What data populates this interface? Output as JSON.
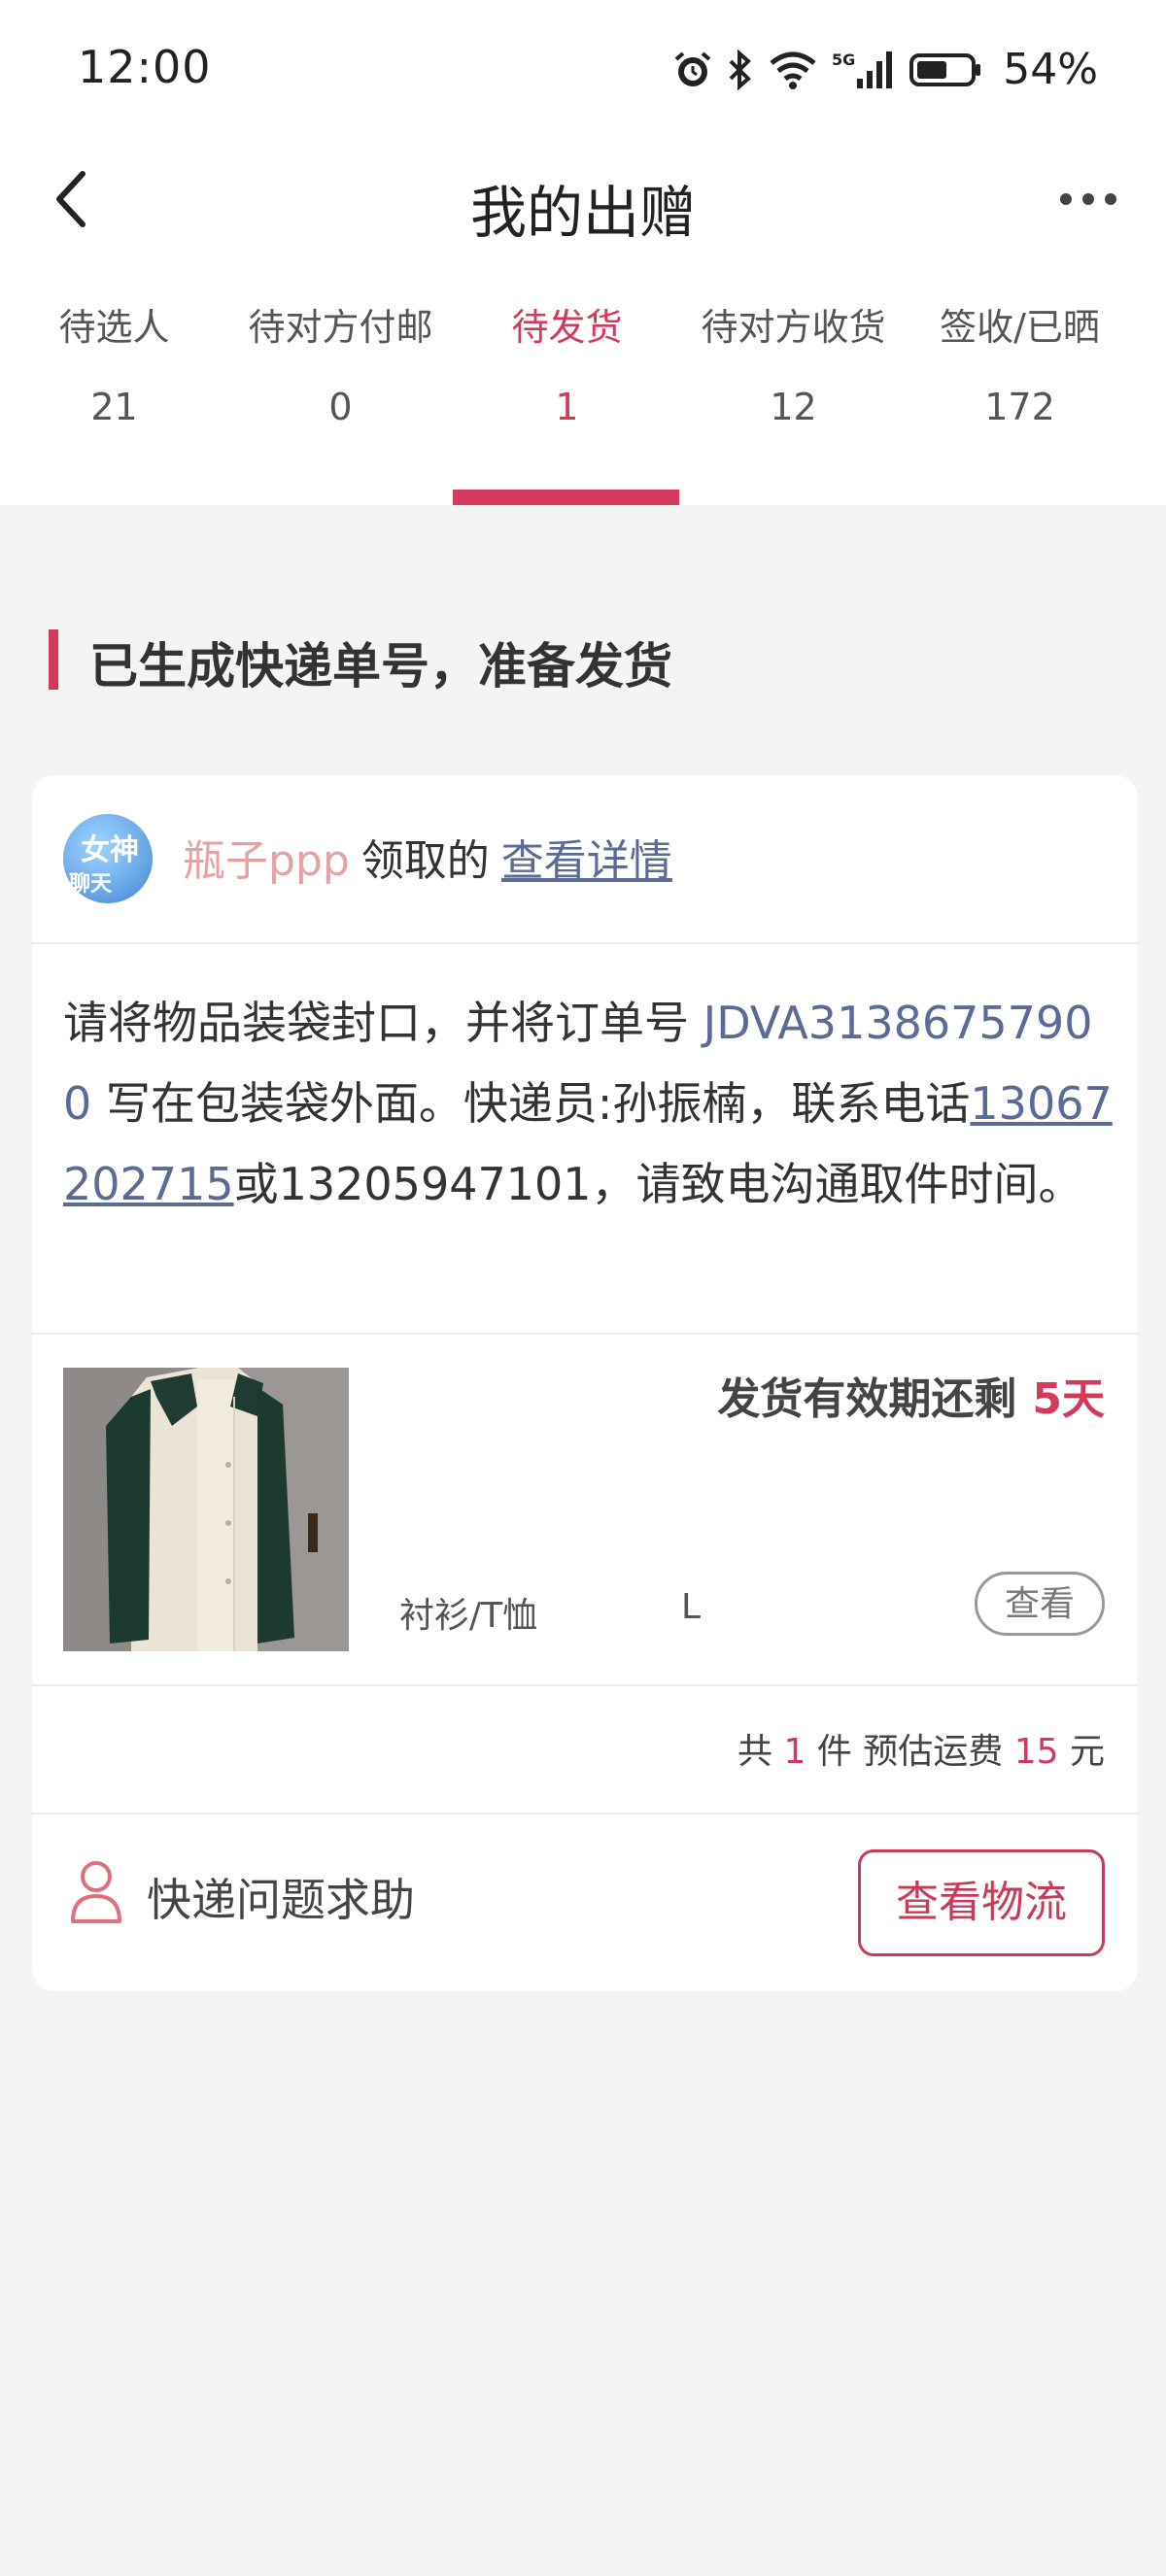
{
  "status_bar": {
    "time": "12:00",
    "network": "5G",
    "battery": "54%"
  },
  "nav": {
    "title": "我的出赠"
  },
  "tabs": [
    {
      "label": "待选人",
      "count": "21"
    },
    {
      "label": "待对方付邮",
      "count": "0"
    },
    {
      "label": "待发货",
      "count": "1",
      "active": true
    },
    {
      "label": "待对方收货",
      "count": "12"
    },
    {
      "label": "签收/已晒",
      "count": "172"
    }
  ],
  "section": {
    "title": "已生成快递单号，准备发货"
  },
  "card": {
    "user": {
      "avatar_text_1": "女神",
      "avatar_text_2": "聊天",
      "username": "瓶子ppp",
      "claimed_text": "领取的",
      "detail_link": "查看详情"
    },
    "instruction": {
      "part1": "请将物品装袋封口，并将订单号 ",
      "order_no": "JDVA31386757900",
      "part2": " 写在包装袋外面。快递员:孙振楠，联系电话",
      "phone1": "13067202715",
      "part3": "或13205947101，请致电沟通取件时间。"
    },
    "product": {
      "deadline_label": "发货有效期还剩",
      "deadline_days": "5天",
      "category": "衬衫/T恤",
      "size": "L",
      "view_button": "查看"
    },
    "summary": {
      "prefix": "共",
      "count": "1",
      "mid": "件 预估运费",
      "fee": "15",
      "suffix": "元"
    },
    "help": {
      "label": "快递问题求助",
      "button": "查看物流"
    }
  },
  "colors": {
    "accent": "#d4395b",
    "link": "#5b6b95",
    "username": "#e8a0a7"
  }
}
